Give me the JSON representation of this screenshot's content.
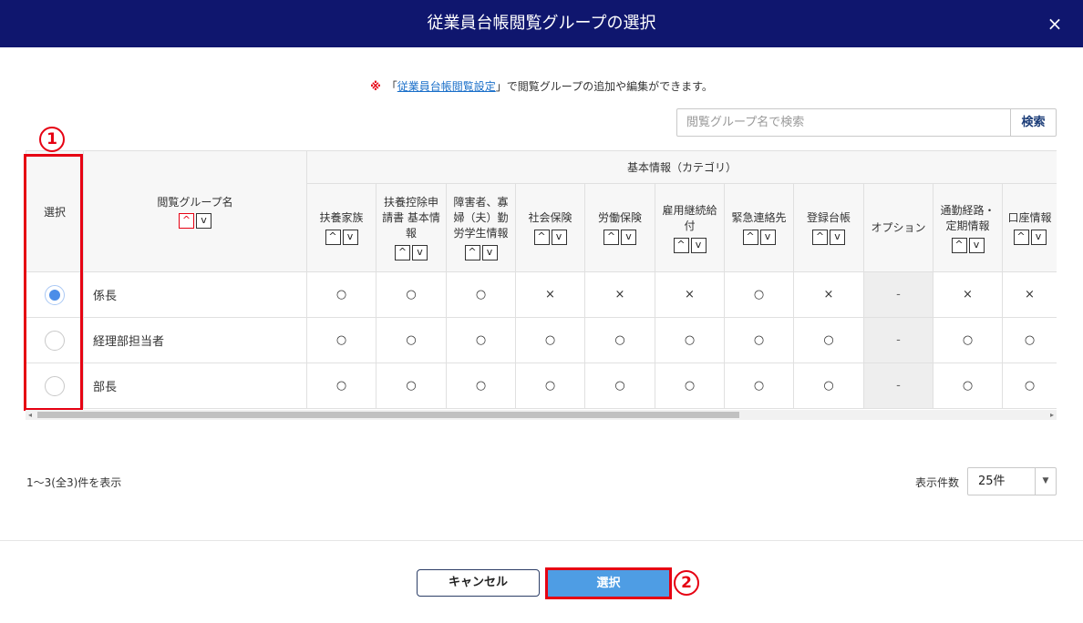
{
  "dialog": {
    "title": "従業員台帳閲覧グループの選択",
    "close_icon": "×"
  },
  "notice": {
    "mark": "※",
    "prefix": "「",
    "link": "従業員台帳閲覧設定",
    "suffix": "」で閲覧グループの追加や編集ができます。"
  },
  "search": {
    "placeholder": "閲覧グループ名で検索",
    "button": "検索"
  },
  "table": {
    "select_header": "選択",
    "name_header": "閲覧グループ名",
    "category_header": "基本情報（カテゴリ）",
    "sort_up": "^",
    "sort_down": "v",
    "columns": [
      "扶養家族",
      "扶養控除申請書 基本情報",
      "障害者、寡婦（夫）勤労学生情報",
      "社会保険",
      "労働保険",
      "雇用継続給付",
      "緊急連絡先",
      "登録台帳",
      "オプション",
      "通勤経路・定期情報",
      "口座情報"
    ],
    "rows": [
      {
        "name": "係長",
        "selected": true,
        "values": [
          "○",
          "○",
          "○",
          "×",
          "×",
          "×",
          "○",
          "×",
          "-",
          "×",
          "×"
        ]
      },
      {
        "name": "経理部担当者",
        "selected": false,
        "values": [
          "○",
          "○",
          "○",
          "○",
          "○",
          "○",
          "○",
          "○",
          "-",
          "○",
          "○"
        ]
      },
      {
        "name": "部長",
        "selected": false,
        "values": [
          "○",
          "○",
          "○",
          "○",
          "○",
          "○",
          "○",
          "○",
          "-",
          "○",
          "○"
        ]
      }
    ]
  },
  "annotations": {
    "marker1": "1",
    "marker2": "2",
    "accent": "#e60012"
  },
  "footer": {
    "count_text": "1〜3(全3)件を表示",
    "per_page_label": "表示件数",
    "per_page_value": "25件"
  },
  "buttons": {
    "cancel": "キャンセル",
    "select": "選択"
  },
  "colors": {
    "titlebar": "#0f166e",
    "primary": "#4e9de4",
    "link": "#1a6fc9"
  }
}
